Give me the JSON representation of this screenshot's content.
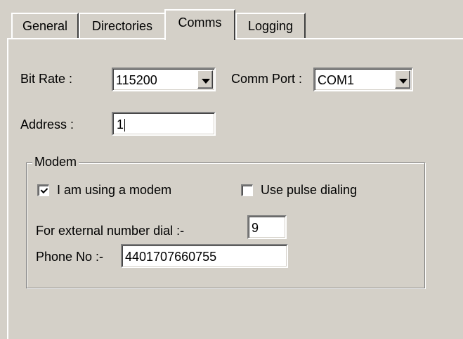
{
  "tabs": [
    {
      "label": "General"
    },
    {
      "label": "Directories"
    },
    {
      "label": "Comms",
      "active": true
    },
    {
      "label": "Logging"
    }
  ],
  "comms": {
    "bit_rate_label": "Bit Rate :",
    "bit_rate_value": "115200",
    "comm_port_label": "Comm Port :",
    "comm_port_value": "COM1",
    "address_label": "Address :",
    "address_value": "1"
  },
  "modem": {
    "group_title": "Modem",
    "using_modem_label": "I am using a modem",
    "using_modem_checked": true,
    "pulse_dialing_label": "Use pulse dialing",
    "pulse_dialing_checked": false,
    "external_dial_label": "For external number dial :-",
    "external_dial_value": "9",
    "phone_label": "Phone No :-",
    "phone_value": "4401707660755"
  },
  "icons": {
    "dropdown": "chevron-down-icon",
    "check": "checkmark-icon"
  },
  "colors": {
    "face": "#d4d0c8",
    "field": "#ffffff",
    "shadow": "#808080",
    "highlight": "#ffffff"
  }
}
